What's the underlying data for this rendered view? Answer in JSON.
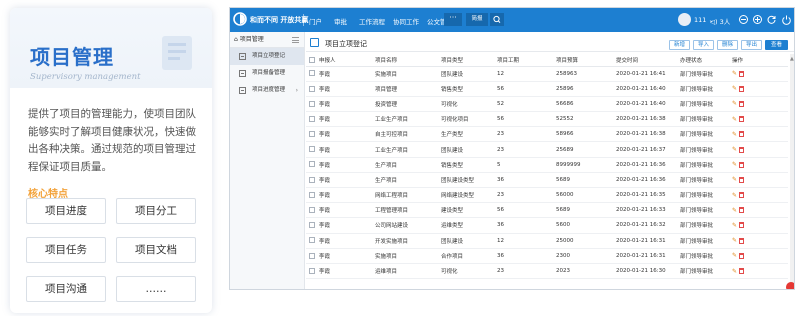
{
  "card": {
    "title": "项目管理",
    "subtitle": "Supervisory management",
    "description": "提供了项目的管理能力，使项目团队能够实时了解项目健康状况，快速做出各种决策。通过规范的项目管理过程保证项目质量。",
    "features_label": "核心特点",
    "features": [
      "项目进度",
      "项目分工",
      "项目任务",
      "项目文档",
      "项目沟通",
      "……"
    ]
  },
  "app": {
    "brand": "和而不同 开放共赢",
    "nav": [
      "门户",
      "审批",
      "工作流程",
      "协同工作",
      "公文管理"
    ],
    "nav_more": "···",
    "nav_extra": "简报",
    "user": "111 ⌄",
    "online": "3人",
    "colors": {
      "topbar": "#1d7fd1",
      "accent": "#2a6fc9",
      "feature_label": "#f2a23a"
    }
  },
  "sidebar": {
    "header": "项目管理",
    "items": [
      {
        "label": "项目立项登记",
        "active": true
      },
      {
        "label": "项目报备管理",
        "active": false
      },
      {
        "label": "项目进度管理",
        "active": false
      }
    ]
  },
  "page": {
    "title": "项目立项登记",
    "buttons": [
      "新增",
      "导入",
      "删除",
      "导出",
      "查看"
    ]
  },
  "table": {
    "columns": [
      "申报人",
      "项目名称",
      "项目类型",
      "项目工期",
      "项目预算",
      "提交时间",
      "办理状态",
      "操作"
    ],
    "rows": [
      [
        "李霞",
        "实施项目",
        "团队建设",
        "12",
        "258963",
        "2020-01-21 16:41",
        "部门领导审批"
      ],
      [
        "李霞",
        "项目管理",
        "销售类型",
        "56",
        "25896",
        "2020-01-21 16:40",
        "部门领导审批"
      ],
      [
        "李霞",
        "投资管理",
        "可视化",
        "52",
        "56686",
        "2020-01-21 16:40",
        "部门领导审批"
      ],
      [
        "李霞",
        "工业生产项目",
        "可视化项目",
        "56",
        "52552",
        "2020-01-21 16:38",
        "部门领导审批"
      ],
      [
        "李霞",
        "自主可控项目",
        "生产类型",
        "23",
        "58966",
        "2020-01-21 16:38",
        "部门领导审批"
      ],
      [
        "李霞",
        "工业生产项目",
        "团队建设",
        "23",
        "25689",
        "2020-01-21 16:37",
        "部门领导审批"
      ],
      [
        "李霞",
        "生产项目",
        "销售类型",
        "5",
        "8999999",
        "2020-01-21 16:36",
        "部门领导审批"
      ],
      [
        "李霞",
        "生产项目",
        "团队建设类型",
        "36",
        "5689",
        "2020-01-21 16:36",
        "部门领导审批"
      ],
      [
        "李霞",
        "网络工程项目",
        "网络建设类型",
        "23",
        "56000",
        "2020-01-21 16:35",
        "部门领导审批"
      ],
      [
        "李霞",
        "工程管理项目",
        "建设类型",
        "56",
        "5689",
        "2020-01-21 16:33",
        "部门领导审批"
      ],
      [
        "李霞",
        "公司网站建设",
        "运维类型",
        "36",
        "5600",
        "2020-01-21 16:32",
        "部门领导审批"
      ],
      [
        "李霞",
        "开发实施项目",
        "团队建设",
        "12",
        "25000",
        "2020-01-21 16:31",
        "部门领导审批"
      ],
      [
        "李霞",
        "实施项目",
        "合作项目",
        "36",
        "2300",
        "2020-01-21 16:31",
        "部门领导审批"
      ],
      [
        "李霞",
        "运维项目",
        "可视化",
        "23",
        "2023",
        "2020-01-21 16:30",
        "部门领导审批"
      ]
    ]
  }
}
